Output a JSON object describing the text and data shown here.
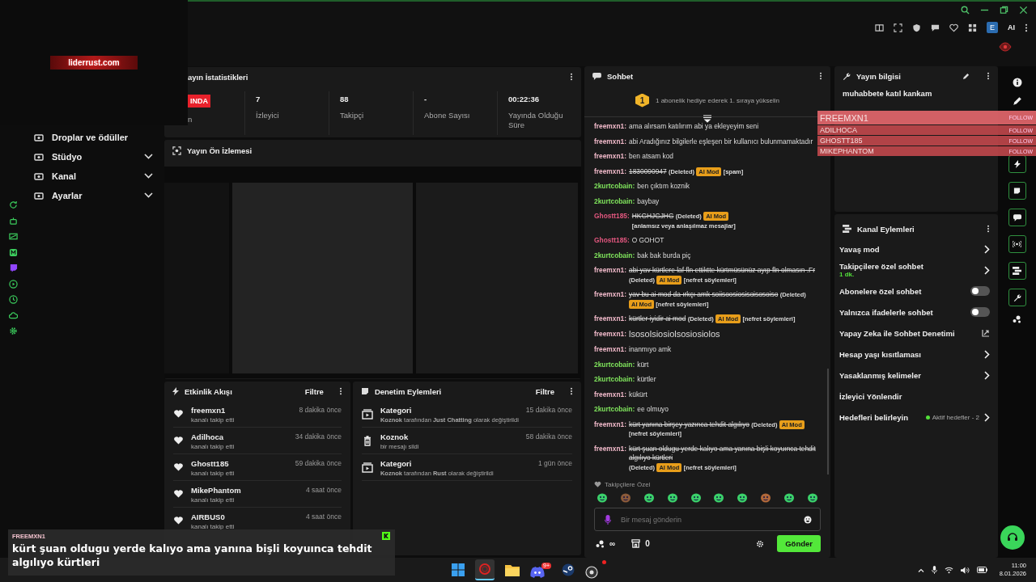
{
  "top_bar": {
    "avatar": "E",
    "ai_label": "AI"
  },
  "logo_overlay": {
    "text": "liderrust.com"
  },
  "nav": [
    {
      "label": "Droplar ve ödüller",
      "kind": "link"
    },
    {
      "label": "Stüdyo",
      "kind": "group",
      "expanded": false
    },
    {
      "label": "Kanal",
      "kind": "group",
      "expanded": false
    },
    {
      "label": "Ayarlar",
      "kind": "group",
      "expanded": false
    }
  ],
  "stats": {
    "title": "ayın İstatistikleri",
    "items": [
      {
        "kind": "badge",
        "value": "INDA",
        "label": "n"
      },
      {
        "kind": "stat",
        "value": "7",
        "label": "İzleyici"
      },
      {
        "kind": "stat",
        "value": "88",
        "label": "Takipçi"
      },
      {
        "kind": "stat",
        "value": "-",
        "label": "Abone Sayısı"
      },
      {
        "kind": "stat",
        "value": "00:22:36",
        "label": "Yayında Olduğu Süre"
      }
    ]
  },
  "preview": {
    "title": "Yayın Ön İzlemesi"
  },
  "activity": {
    "title": "Etkinlik Akışı",
    "filter": "Filtre",
    "items": [
      {
        "name": "freemxn1",
        "action": "kanalı takip etti",
        "time": "8 dakika önce"
      },
      {
        "name": "Adilhoca",
        "action": "kanalı takip etti",
        "time": "34 dakika önce"
      },
      {
        "name": "Ghostt185",
        "action": "kanalı takip etti",
        "time": "59 dakika önce"
      },
      {
        "name": "MikePhantom",
        "action": "kanalı takip etti",
        "time": "4 saat önce"
      },
      {
        "name": "AIRBUS0",
        "action": "kanalı takip etti",
        "time": "4 saat önce"
      }
    ]
  },
  "moderation": {
    "title": "Denetim Eylemleri",
    "filter": "Filtre",
    "items": [
      {
        "kind": "category",
        "title": "Kategori",
        "detail": "**Koznok** tarafından **Just Chatting** olarak değiştirildi",
        "time": "15 dakika önce"
      },
      {
        "kind": "delete",
        "title": "Koznok",
        "detail": "bir mesajı sildi",
        "time": "58 dakika önce"
      },
      {
        "kind": "category",
        "title": "Kategori",
        "detail": "**Koznok** tarafından **Rust** olarak değiştirildi",
        "time": "1 gün önce"
      }
    ]
  },
  "chat": {
    "title": "Sohbet",
    "pinned": {
      "rank": "1",
      "text": "1 abonelik hediye ederek 1. sıraya yükselin"
    },
    "messages": [
      {
        "user": "freemxn1:",
        "color": "#f0b9c9",
        "text": "ama alırsam katılırım abi ya ekleyeyim seni",
        "deleted": false,
        "kind": "normal"
      },
      {
        "user": "freemxn1:",
        "color": "#f0b9c9",
        "text": "abi Aradığınız bilgilerle eşleşen bir kullanıcı bulunmamaktadır",
        "deleted": false,
        "kind": "normal"
      },
      {
        "user": "freemxn1:",
        "color": "#f0b9c9",
        "text": "ben atsam kod",
        "deleted": false,
        "kind": "normal"
      },
      {
        "user": "freemxn1:",
        "color": "#f0b9c9",
        "text": "1830090947",
        "deleted": true,
        "kind": "normal",
        "deleted_label": "(Deleted)",
        "mod_badge": "AI Mod",
        "reason": "[spam]"
      },
      {
        "user": "2kurtcobain:",
        "color": "#7fe35c",
        "text": "ben çıktım koznik",
        "deleted": false,
        "kind": "normal"
      },
      {
        "user": "2kurtcobain:",
        "color": "#7fe35c",
        "text": "baybay",
        "deleted": false,
        "kind": "normal"
      },
      {
        "user": "Ghostt185:",
        "color": "#e2577f",
        "text": "HKGHJGJHG",
        "deleted": true,
        "kind": "normal",
        "deleted_label": "(Deleted)",
        "mod_badge": "AI Mod",
        "reason": "[anlamsız veya anlaşılmaz mesajlar]"
      },
      {
        "user": "Ghostt185:",
        "color": "#e2577f",
        "text": "O GOHOT",
        "deleted": false,
        "kind": "normal"
      },
      {
        "user": "2kurtcobain:",
        "color": "#7fe35c",
        "text": "bak bak burda piç",
        "deleted": false,
        "kind": "normal"
      },
      {
        "user": "freemxn1:",
        "color": "#f0b9c9",
        "text": "abi yav kürtlere laf fln ettiktte kürtmüsünüz ayıp fln olmasın .Fr",
        "deleted": true,
        "kind": "normal",
        "deleted_label": "(Deleted)",
        "mod_badge": "AI Mod",
        "reason": "[nefret söylemleri]"
      },
      {
        "user": "freemxn1:",
        "color": "#f0b9c9",
        "text": "yav bu ai mod da ırkçı amk soiisoosiosisoisosoiso",
        "deleted": true,
        "kind": "normal",
        "deleted_label": "(Deleted)",
        "mod_badge": "AI Mod",
        "reason": "[nefret söylemleri]"
      },
      {
        "user": "freemxn1:",
        "color": "#f0b9c9",
        "text": "kürtler iyidir ai mod",
        "deleted": true,
        "kind": "normal",
        "deleted_label": "(Deleted)",
        "mod_badge": "AI Mod",
        "reason": "[nefret söylemleri]"
      },
      {
        "user": "freemxn1:",
        "color": "#f0b9c9",
        "text": "lsosolsiosiolsosiosiolos",
        "deleted": false,
        "kind": "large"
      },
      {
        "user": "freemxn1:",
        "color": "#f0b9c9",
        "text": "inanmıyo amk",
        "deleted": false,
        "kind": "normal"
      },
      {
        "user": "2kurtcobain:",
        "color": "#7fe35c",
        "text": "kürt",
        "deleted": false,
        "kind": "normal"
      },
      {
        "user": "2kurtcobain:",
        "color": "#7fe35c",
        "text": "kürtler",
        "deleted": false,
        "kind": "normal"
      },
      {
        "user": "freemxn1:",
        "color": "#f0b9c9",
        "text": "kükürt",
        "deleted": false,
        "kind": "normal"
      },
      {
        "user": "2kurtcobain:",
        "color": "#7fe35c",
        "text": "ee olmuyo",
        "deleted": false,
        "kind": "normal"
      },
      {
        "user": "freemxn1:",
        "color": "#f0b9c9",
        "text": "kürt yanına birşey yazınca tehdit algılıyo",
        "deleted": true,
        "kind": "normal",
        "deleted_label": "(Deleted)",
        "mod_badge": "AI Mod",
        "reason": "[nefret söylemleri]"
      },
      {
        "user": "freemxn1:",
        "color": "#f0b9c9",
        "text": "kürt şuan oldugu yerde kalıyo ama yanına bişli koyuınca tehdit algılıyo kürtleri",
        "deleted": true,
        "kind": "normal",
        "deleted_label": "(Deleted)",
        "mod_badge": "AI Mod",
        "reason": "[nefret söylemleri]"
      }
    ],
    "emote_label": "Takipçilere Özel",
    "input": {
      "placeholder": "Bir mesaj gönderin"
    },
    "points": "∞",
    "store_count": "0",
    "send": "Gönder"
  },
  "stream_info": {
    "title": "Yayın bilgisi",
    "stream_title": "muhabbete katıl kankam"
  },
  "channel_actions": {
    "title": "Kanal Eylemleri",
    "items": [
      {
        "kind": "chevron",
        "label": "Yavaş mod"
      },
      {
        "kind": "chevron",
        "label": "Takipçilere özel sohbet",
        "sub": "1 dk."
      },
      {
        "kind": "toggle",
        "label": "Abonelere özel sohbet",
        "on": false
      },
      {
        "kind": "toggle",
        "label": "Yalnızca ifadelerle sohbet",
        "on": false
      },
      {
        "kind": "external",
        "label": "Yapay Zeka ile Sohbet Denetimi"
      },
      {
        "kind": "chevron",
        "label": "Hesap yaşı kısıtlaması"
      },
      {
        "kind": "chevron",
        "label": "Yasaklanmış kelimeler"
      },
      {
        "kind": "plain",
        "label": "İzleyici Yönlendir"
      },
      {
        "kind": "goals",
        "label": "Hedefleri belirleyin",
        "status": "Aktif hedefler - 2"
      }
    ]
  },
  "follow_alerts": [
    {
      "name": "FREEMXN1",
      "action": "FOLLOW"
    },
    {
      "name": "ADILHOCA",
      "action": "FOLLOW"
    },
    {
      "name": "GHOSTT185",
      "action": "FOLLOW"
    },
    {
      "name": "MIKEPHANTOM",
      "action": "FOLLOW"
    }
  ],
  "chat_overlay": {
    "user": "FREEMXN1",
    "message": "kürt şuan oldugu yerde kalıyo ama yanına bişli koyuınca tehdit algılıyo kürtleri"
  },
  "taskbar": {
    "badge": "9+",
    "time": "11:00",
    "date": "8.01.2026"
  }
}
